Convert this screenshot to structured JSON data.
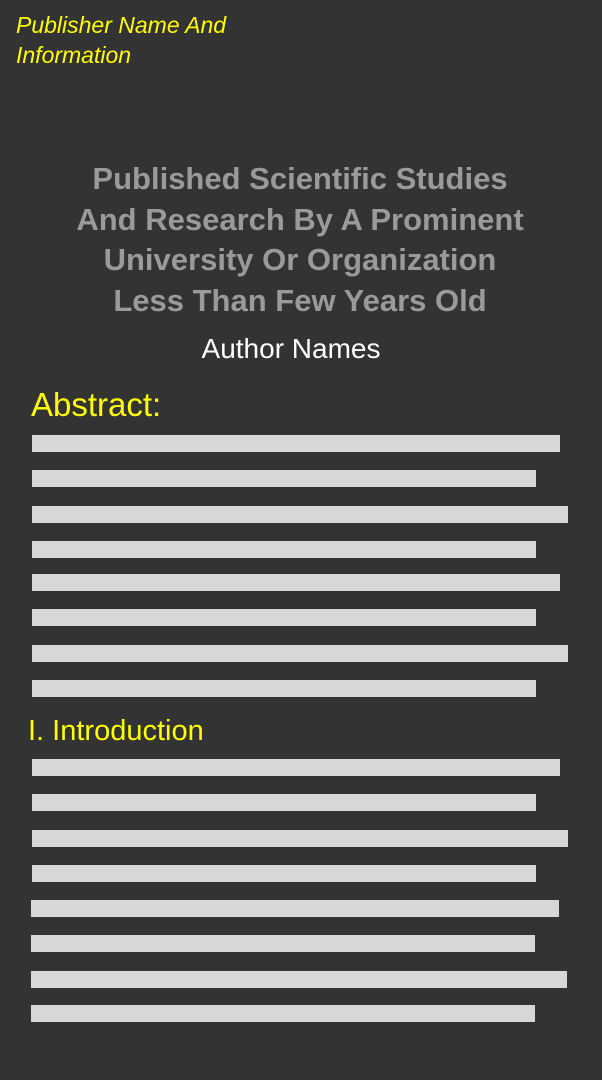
{
  "publisher": {
    "line1": "Publisher Name And",
    "line2": "Information"
  },
  "paper": {
    "title_lines": [
      "Published Scientific Studies",
      "And Research By A Prominent",
      "University Or Organization",
      "Less Than Few Years Old"
    ],
    "authors": "Author Names"
  },
  "sections": {
    "abstract": {
      "heading": "Abstract:"
    },
    "introduction": {
      "heading": "I. Introduction"
    }
  },
  "colors": {
    "background": "#333333",
    "heading_accent": "#ffff00",
    "title": "#9a9a9a",
    "text_placeholder": "#d8d7d8"
  }
}
